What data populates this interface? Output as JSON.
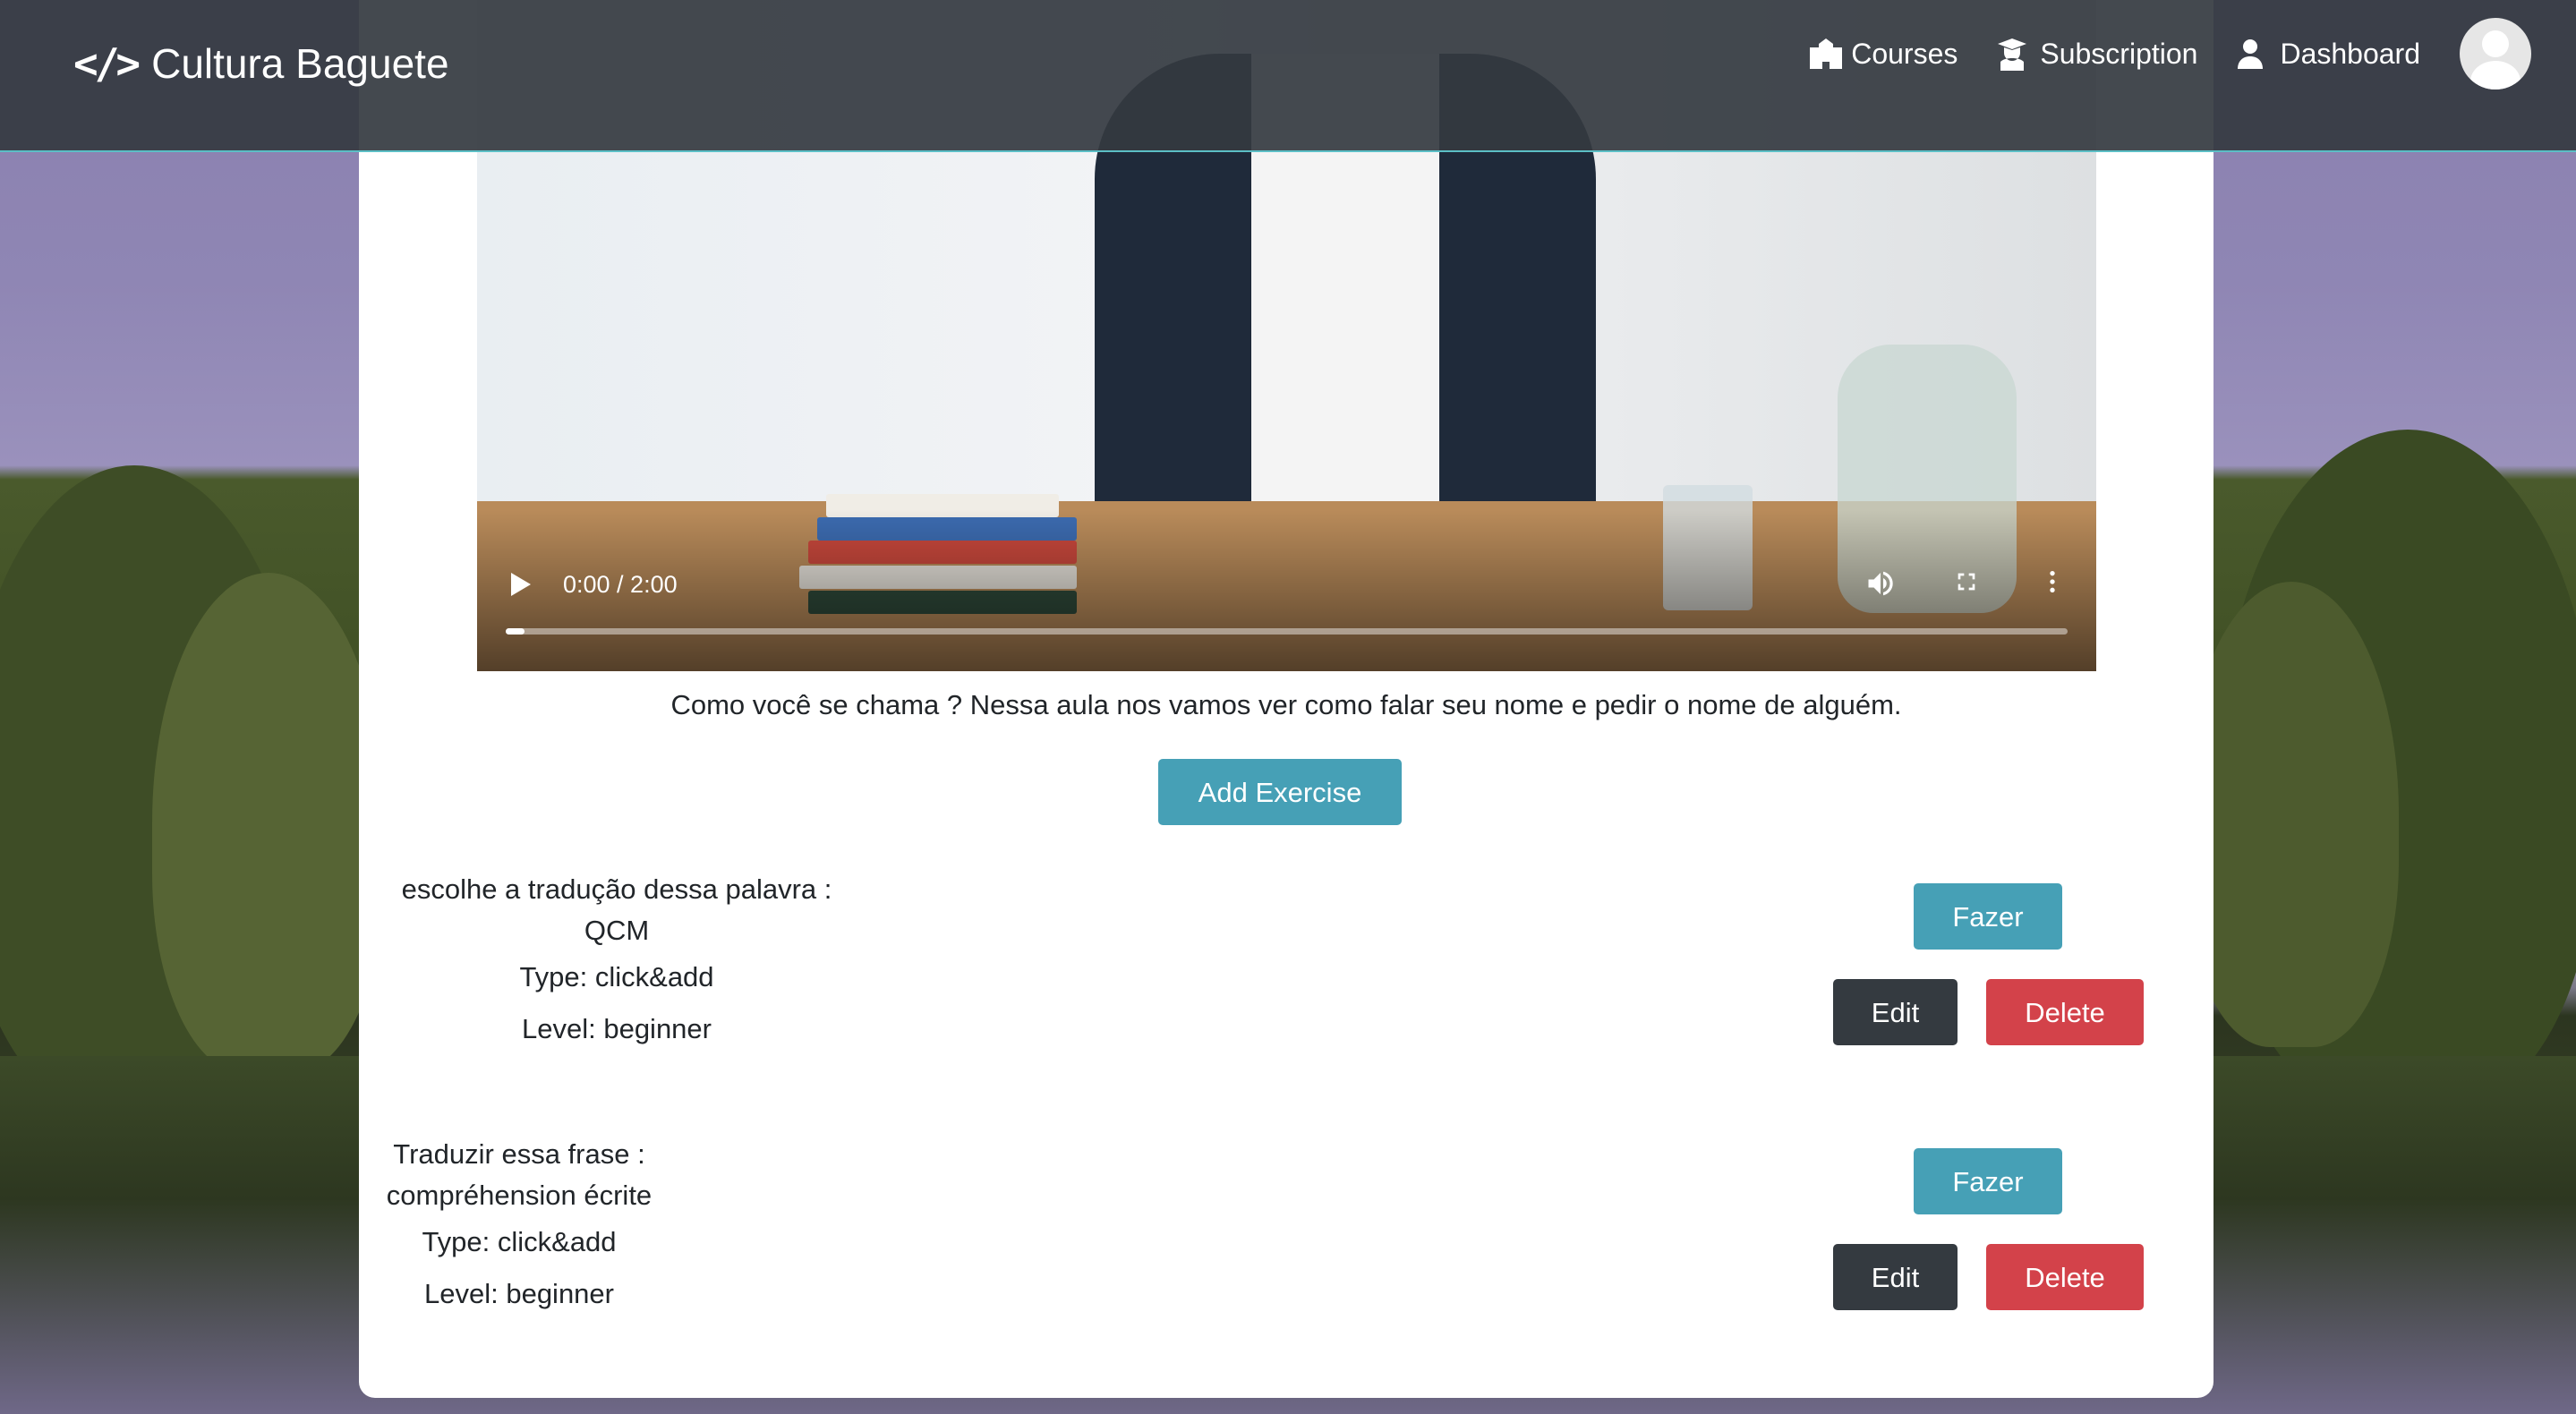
{
  "brand": {
    "icon": "code-icon",
    "name": "Cultura Baguete"
  },
  "nav": [
    {
      "icon": "school-icon",
      "label": "Courses"
    },
    {
      "icon": "graduate-icon",
      "label": "Subscription"
    },
    {
      "icon": "user-icon",
      "label": "Dashboard"
    }
  ],
  "user": {
    "avatar_icon": "user-avatar-icon"
  },
  "video": {
    "time": "0:00 / 2:00",
    "progress": 0.012,
    "controls": [
      "play-icon",
      "volume-icon",
      "fullscreen-icon",
      "more-vertical-icon"
    ]
  },
  "lesson": {
    "description": "Como você se chama ? Nessa aula nos vamos ver como falar seu nome e pedir o nome de alguém.",
    "add_exercise_label": "Add Exercise"
  },
  "exercises": [
    {
      "title": "escolhe a tradução dessa palavra :",
      "subtitle": "QCM",
      "type": "Type: click&add",
      "level": "Level: beginner",
      "do_label": "Fazer",
      "edit_label": "Edit",
      "delete_label": "Delete"
    },
    {
      "title": "Traduzir essa frase :",
      "subtitle": "compréhension écrite",
      "type": "Type: click&add",
      "level": "Level: beginner",
      "do_label": "Fazer",
      "edit_label": "Edit",
      "delete_label": "Delete"
    }
  ],
  "colors": {
    "navbar": "#343a40",
    "info": "#46a0b6",
    "dark": "#343a40",
    "danger": "#d3424a"
  }
}
